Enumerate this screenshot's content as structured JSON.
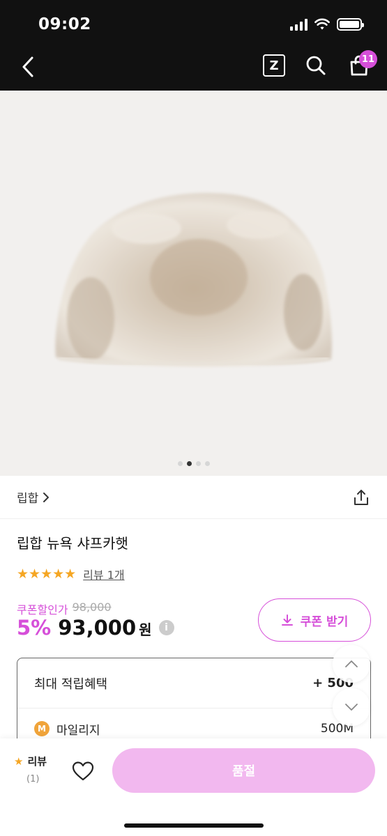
{
  "status": {
    "time": "09:02"
  },
  "header": {
    "z_label": "Z",
    "cart_count": "11"
  },
  "gallery": {
    "total": 4,
    "active": 1
  },
  "brand": {
    "name": "립합"
  },
  "product": {
    "title": "립합 뉴욕 샤프카햇",
    "rating_stars": "★★★★★",
    "review_link": "리뷰 1개",
    "coupon_label": "쿠폰할인가",
    "original_price": "98,000",
    "discount": "5%",
    "price": "93,000",
    "currency": "원",
    "info_icon": "i"
  },
  "coupon_button": {
    "label": "쿠폰 받기"
  },
  "benefits": {
    "title": "최대 적립혜택",
    "total": "+ 500",
    "mileage_badge": "M",
    "mileage_label": "마일리지",
    "mileage_value": "500M"
  },
  "bottom": {
    "review_label": "리뷰",
    "review_count": "(1)",
    "soldout_label": "품절"
  },
  "colors": {
    "accent": "#d64fd9",
    "soldout": "#f2b8ef",
    "star": "#f5a623",
    "header_bg": "#111111"
  }
}
